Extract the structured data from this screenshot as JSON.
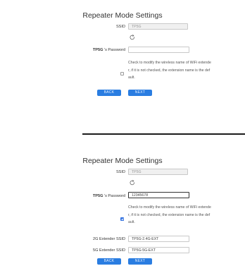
{
  "top": {
    "title": "Repeater Mode Settings",
    "ssid_label": "SSID",
    "ssid_value": "TP5G",
    "password_label_prefix": "TP5G",
    "password_label_suffix": " 's Password",
    "password_value": "",
    "note_line1": "Check to modify the wireless name of WiFi extende",
    "note_line2": "r, if it is not checked, the extension name is the def",
    "note_line3": "ault.",
    "back_label": "BACK",
    "next_label": "NEXT"
  },
  "bottom": {
    "title": "Repeater Mode Settings",
    "ssid_label": "SSID",
    "ssid_value": "TP5G",
    "password_label_prefix": "TP5G",
    "password_label_suffix": " 's Password",
    "password_value": "12345678",
    "note_line1": "Check to modify the wireless name of WiFi extende",
    "note_line2": "r, if it is not checked, the extension name is the def",
    "note_line3": "ault.",
    "ext2g_label": "2G Extender SSID",
    "ext2g_value": "TP5G-2.4G-EXT",
    "ext5g_label": "5G Extender SSID",
    "ext5g_value": "TP5G-5G-EXT",
    "back_label": "BACK",
    "next_label": "NEXT"
  },
  "colors": {
    "accent": "#2a7de1",
    "checkbox_checked": "#2f6fe0",
    "divider": "#1c1c1c"
  }
}
